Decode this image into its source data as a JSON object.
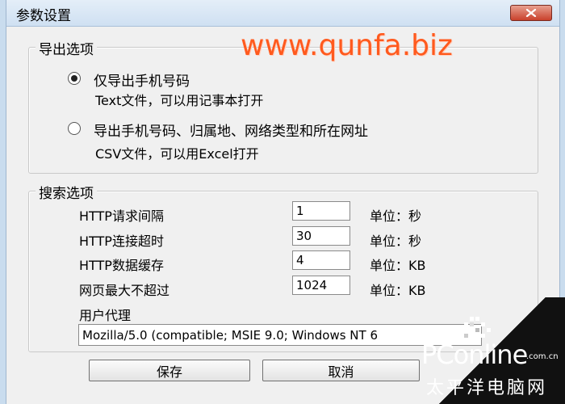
{
  "window": {
    "title": "参数设置"
  },
  "export_options": {
    "group_label": "导出选项",
    "watermark": "www.qunfa.biz",
    "options": [
      {
        "label": "仅导出手机号码",
        "desc": "Text文件，可以用记事本打开",
        "checked": true
      },
      {
        "label": "导出手机号码、归属地、网络类型和所在网址",
        "desc": "CSV文件，可以用Excel打开",
        "checked": false
      }
    ]
  },
  "search_options": {
    "group_label": "搜索选项",
    "fields": [
      {
        "label": "HTTP请求间隔",
        "value": "1",
        "unit": "单位：秒"
      },
      {
        "label": "HTTP连接超时",
        "value": "30",
        "unit": "单位：秒"
      },
      {
        "label": "HTTP数据缓存",
        "value": "4",
        "unit": "单位：KB"
      },
      {
        "label": "网页最大不超过",
        "value": "1024",
        "unit": "单位：KB"
      }
    ],
    "user_agent_label": "用户代理",
    "user_agent_value": "Mozilla/5.0 (compatible; MSIE 9.0; Windows NT 6"
  },
  "buttons": {
    "save": "保存",
    "cancel": "取消"
  },
  "branding": {
    "logo_text": "PConline",
    "logo_domain": ".com.cn",
    "logo_cn": "太平洋电脑网"
  },
  "colors": {
    "watermark": "#ff5a1e",
    "title_bar": "#cfe0f2",
    "close_button": "#c9412c"
  }
}
